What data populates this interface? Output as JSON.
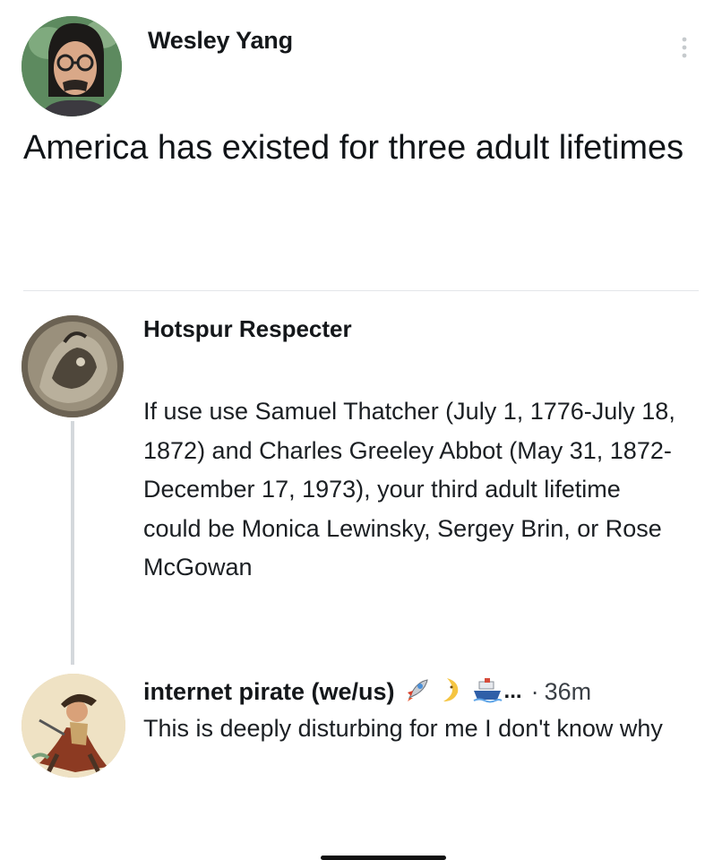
{
  "op": {
    "author_name": "Wesley Yang",
    "text": "America has existed for three adult lifetimes"
  },
  "reply1": {
    "author_name": "Hotspur Respecter",
    "text": "If use use Samuel Thatcher (July 1, 1776-July 18, 1872) and Charles Greeley Abbot (May 31, 1872-December 17, 1973), your third adult lifetime could be Monica Lewinsky, Sergey Brin, or Rose McGowan"
  },
  "reply2": {
    "author_name": "internet pirate (we/us)",
    "name_emojis": [
      "rocket-icon",
      "crescent-moon-icon",
      "ship-icon"
    ],
    "ellipsis": "...",
    "separator": "·",
    "timestamp": "36m",
    "text": "This is deeply disturbing for me I don't know why"
  }
}
